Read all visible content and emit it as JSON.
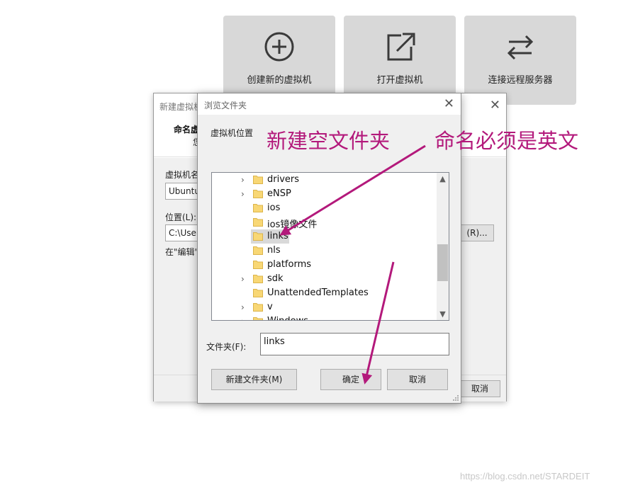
{
  "tiles": [
    {
      "label": "创建新的虚拟机",
      "icon": "plus-circle-icon"
    },
    {
      "label": "打开虚拟机",
      "icon": "open-external-icon"
    },
    {
      "label": "连接远程服务器",
      "icon": "swap-arrows-icon"
    }
  ],
  "wizard": {
    "title": "新建虚拟机",
    "header_title": "命名虚",
    "header_sub": "您",
    "name_label": "虚拟机名",
    "name_value": "Ubuntu",
    "location_label": "位置(L):",
    "location_value": "C:\\User",
    "browse_button": "(R)...",
    "hint_text": "在\"编辑\"",
    "cancel_button": "取消"
  },
  "browse_dialog": {
    "title": "浏览文件夹",
    "description": "虚拟机位置",
    "tree": [
      {
        "name": "drivers",
        "expandable": true,
        "selected": false
      },
      {
        "name": "eNSP",
        "expandable": true,
        "selected": false
      },
      {
        "name": "ios",
        "expandable": false,
        "selected": false
      },
      {
        "name": "ios镜像文件",
        "expandable": false,
        "selected": false
      },
      {
        "name": "links",
        "expandable": false,
        "selected": true
      },
      {
        "name": "nls",
        "expandable": false,
        "selected": false
      },
      {
        "name": "platforms",
        "expandable": false,
        "selected": false
      },
      {
        "name": "sdk",
        "expandable": true,
        "selected": false
      },
      {
        "name": "UnattendedTemplates",
        "expandable": false,
        "selected": false
      },
      {
        "name": "v",
        "expandable": true,
        "selected": false
      },
      {
        "name": "Windows",
        "expandable": true,
        "selected": false
      }
    ],
    "folder_label": "文件夹(F):",
    "folder_value": "links",
    "new_folder_button": "新建文件夹(M)",
    "ok_button": "确定",
    "cancel_button": "取消"
  },
  "annotation": {
    "text1": "新建空文件夹",
    "text2": "命名必须是英文",
    "color": "#b3197b"
  },
  "watermark": "https://blog.csdn.net/STARDEIT"
}
